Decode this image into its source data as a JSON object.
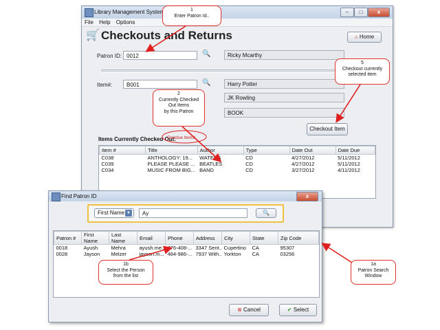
{
  "main_window": {
    "title": "Library Management System",
    "menu": [
      "File",
      "Help",
      "Options"
    ],
    "page_title": "Checkouts and Returns",
    "home_label": "Home",
    "patron_id_label": "Patron ID:",
    "patron_id_value": "0012",
    "patron_name": "Ricky Mcarthy",
    "item_label": "Item#:",
    "item_value": "B001",
    "item_title": "Harry Potter",
    "item_author": "JK Rowling",
    "item_type": "BOOK",
    "checkout_label": "Checkout Item",
    "items_heading": "Items Currently Checked Out:",
    "overdue_label": "Overdue Items!",
    "table_headers": [
      "Item #",
      "Title",
      "Author",
      "Type",
      "Date Out",
      "Date Due"
    ],
    "rows": [
      [
        "C038",
        "ANTHOLOGY: 19...",
        "WATERS",
        "CD",
        "4/27/2012",
        "5/11/2012"
      ],
      [
        "C039",
        "PLEASE PLEASE ...",
        "BEATLES",
        "CD",
        "4/27/2012",
        "5/11/2012"
      ],
      [
        "C034",
        "MUSIC FROM BIG...",
        "BAND",
        "CD",
        "3/27/2012",
        "4/11/2012"
      ]
    ]
  },
  "dialog": {
    "title": "Find Patron ID",
    "search_by": "First Name",
    "search_value": "Ay",
    "table_headers": [
      "Patron #",
      "First Name",
      "Last Name",
      "Email",
      "Phone",
      "Address",
      "City",
      "State",
      "Zip Code"
    ],
    "rows": [
      [
        "0018",
        "Ayush",
        "Mehra",
        "ayush.me...",
        "476-408-...",
        "3347 Sent...",
        "Cupertino",
        "CA",
        "95307"
      ],
      [
        "0028",
        "Jayson",
        "Melzer",
        "jayson.m...",
        "484-986-...",
        "7937 With...",
        "Yorkton",
        "CA",
        "03256"
      ]
    ],
    "cancel_label": "Cancel",
    "select_label": "Select"
  },
  "callouts": {
    "c1": [
      "1",
      "Enter Patron Id.."
    ],
    "c2": [
      "2",
      "Currently Checked",
      "Out Items",
      "by this Patron"
    ],
    "c5": [
      "5",
      "Checkout currently",
      "selected item"
    ],
    "c1b": [
      "1b",
      "Select the Person",
      "from the list"
    ],
    "c1a": [
      "1a",
      "Patron Search",
      "Window"
    ]
  },
  "colors": {
    "callout_border": "#e0302a",
    "arrow": "#e02020",
    "highlight": "#f0c040",
    "overdue": "#d02020"
  }
}
